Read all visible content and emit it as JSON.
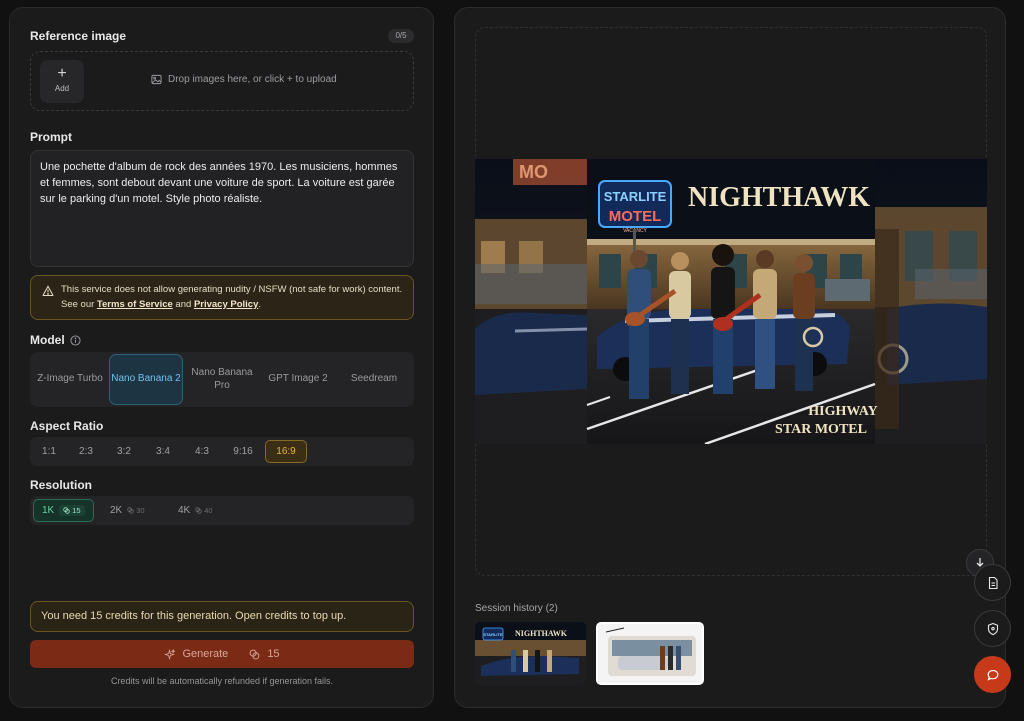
{
  "reference": {
    "title": "Reference image",
    "counter": "0/5",
    "add_label": "Add",
    "drop_hint": "Drop images here, or click + to upload"
  },
  "prompt": {
    "title": "Prompt",
    "text": "Une pochette d'album de rock des années 1970. Les musiciens, hommes et femmes, sont debout devant une voiture de sport. La voiture est garée sur le parking d'un motel. Style photo réaliste."
  },
  "warning": {
    "text_before": "This service does not allow generating nudity / NSFW (not safe for work) content. See our ",
    "tos": "Terms of Service",
    "and": " and ",
    "privacy": "Privacy Policy",
    "end": "."
  },
  "model": {
    "title": "Model",
    "options": [
      "Z-Image Turbo",
      "Nano Banana 2",
      "Nano Banana Pro",
      "GPT Image 2",
      "Seedream"
    ],
    "selected": "Nano Banana 2"
  },
  "aspect": {
    "title": "Aspect Ratio",
    "options": [
      "1:1",
      "2:3",
      "3:2",
      "3:4",
      "4:3",
      "9:16",
      "16:9"
    ],
    "selected": "16:9"
  },
  "resolution": {
    "title": "Resolution",
    "options": [
      {
        "label": "1K",
        "cost": "15"
      },
      {
        "label": "2K",
        "cost": "30"
      },
      {
        "label": "4K",
        "cost": "40"
      }
    ],
    "selected": "1K"
  },
  "credits": {
    "notice": "You need 15 credits for this generation. Open credits to top up.",
    "generate_label": "Generate",
    "generate_cost": "15",
    "refund_note": "Credits will be automatically refunded if generation fails."
  },
  "preview": {
    "album_title": "NIGHTHAWK",
    "sign_line1": "STARLITE",
    "sign_line2": "MOTEL",
    "sign_small": "VACANCY",
    "subtitle_line1": "HIGHWAY",
    "subtitle_line2": "STAR MOTEL",
    "bg_sign": "MO"
  },
  "history": {
    "title": "Session history (2)",
    "thumb1_title": "NIGHTHAWK",
    "thumb1_sign": "STARLITE"
  },
  "colors": {
    "accent_blue": "#6fc2ec",
    "accent_amber": "#e5b440",
    "accent_green": "#66d2a2",
    "generate_bg": "#7a2a15",
    "chat_fab": "#c63a1a"
  }
}
